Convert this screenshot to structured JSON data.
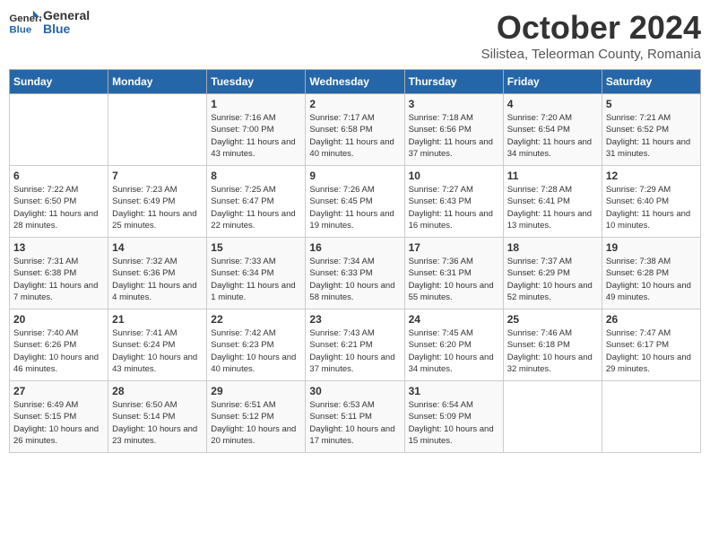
{
  "logo": {
    "general": "General",
    "blue": "Blue"
  },
  "title": "October 2024",
  "subtitle": "Silistea, Teleorman County, Romania",
  "headers": [
    "Sunday",
    "Monday",
    "Tuesday",
    "Wednesday",
    "Thursday",
    "Friday",
    "Saturday"
  ],
  "weeks": [
    [
      {
        "day": "",
        "info": ""
      },
      {
        "day": "",
        "info": ""
      },
      {
        "day": "1",
        "info": "Sunrise: 7:16 AM\nSunset: 7:00 PM\nDaylight: 11 hours and 43 minutes."
      },
      {
        "day": "2",
        "info": "Sunrise: 7:17 AM\nSunset: 6:58 PM\nDaylight: 11 hours and 40 minutes."
      },
      {
        "day": "3",
        "info": "Sunrise: 7:18 AM\nSunset: 6:56 PM\nDaylight: 11 hours and 37 minutes."
      },
      {
        "day": "4",
        "info": "Sunrise: 7:20 AM\nSunset: 6:54 PM\nDaylight: 11 hours and 34 minutes."
      },
      {
        "day": "5",
        "info": "Sunrise: 7:21 AM\nSunset: 6:52 PM\nDaylight: 11 hours and 31 minutes."
      }
    ],
    [
      {
        "day": "6",
        "info": "Sunrise: 7:22 AM\nSunset: 6:50 PM\nDaylight: 11 hours and 28 minutes."
      },
      {
        "day": "7",
        "info": "Sunrise: 7:23 AM\nSunset: 6:49 PM\nDaylight: 11 hours and 25 minutes."
      },
      {
        "day": "8",
        "info": "Sunrise: 7:25 AM\nSunset: 6:47 PM\nDaylight: 11 hours and 22 minutes."
      },
      {
        "day": "9",
        "info": "Sunrise: 7:26 AM\nSunset: 6:45 PM\nDaylight: 11 hours and 19 minutes."
      },
      {
        "day": "10",
        "info": "Sunrise: 7:27 AM\nSunset: 6:43 PM\nDaylight: 11 hours and 16 minutes."
      },
      {
        "day": "11",
        "info": "Sunrise: 7:28 AM\nSunset: 6:41 PM\nDaylight: 11 hours and 13 minutes."
      },
      {
        "day": "12",
        "info": "Sunrise: 7:29 AM\nSunset: 6:40 PM\nDaylight: 11 hours and 10 minutes."
      }
    ],
    [
      {
        "day": "13",
        "info": "Sunrise: 7:31 AM\nSunset: 6:38 PM\nDaylight: 11 hours and 7 minutes."
      },
      {
        "day": "14",
        "info": "Sunrise: 7:32 AM\nSunset: 6:36 PM\nDaylight: 11 hours and 4 minutes."
      },
      {
        "day": "15",
        "info": "Sunrise: 7:33 AM\nSunset: 6:34 PM\nDaylight: 11 hours and 1 minute."
      },
      {
        "day": "16",
        "info": "Sunrise: 7:34 AM\nSunset: 6:33 PM\nDaylight: 10 hours and 58 minutes."
      },
      {
        "day": "17",
        "info": "Sunrise: 7:36 AM\nSunset: 6:31 PM\nDaylight: 10 hours and 55 minutes."
      },
      {
        "day": "18",
        "info": "Sunrise: 7:37 AM\nSunset: 6:29 PM\nDaylight: 10 hours and 52 minutes."
      },
      {
        "day": "19",
        "info": "Sunrise: 7:38 AM\nSunset: 6:28 PM\nDaylight: 10 hours and 49 minutes."
      }
    ],
    [
      {
        "day": "20",
        "info": "Sunrise: 7:40 AM\nSunset: 6:26 PM\nDaylight: 10 hours and 46 minutes."
      },
      {
        "day": "21",
        "info": "Sunrise: 7:41 AM\nSunset: 6:24 PM\nDaylight: 10 hours and 43 minutes."
      },
      {
        "day": "22",
        "info": "Sunrise: 7:42 AM\nSunset: 6:23 PM\nDaylight: 10 hours and 40 minutes."
      },
      {
        "day": "23",
        "info": "Sunrise: 7:43 AM\nSunset: 6:21 PM\nDaylight: 10 hours and 37 minutes."
      },
      {
        "day": "24",
        "info": "Sunrise: 7:45 AM\nSunset: 6:20 PM\nDaylight: 10 hours and 34 minutes."
      },
      {
        "day": "25",
        "info": "Sunrise: 7:46 AM\nSunset: 6:18 PM\nDaylight: 10 hours and 32 minutes."
      },
      {
        "day": "26",
        "info": "Sunrise: 7:47 AM\nSunset: 6:17 PM\nDaylight: 10 hours and 29 minutes."
      }
    ],
    [
      {
        "day": "27",
        "info": "Sunrise: 6:49 AM\nSunset: 5:15 PM\nDaylight: 10 hours and 26 minutes."
      },
      {
        "day": "28",
        "info": "Sunrise: 6:50 AM\nSunset: 5:14 PM\nDaylight: 10 hours and 23 minutes."
      },
      {
        "day": "29",
        "info": "Sunrise: 6:51 AM\nSunset: 5:12 PM\nDaylight: 10 hours and 20 minutes."
      },
      {
        "day": "30",
        "info": "Sunrise: 6:53 AM\nSunset: 5:11 PM\nDaylight: 10 hours and 17 minutes."
      },
      {
        "day": "31",
        "info": "Sunrise: 6:54 AM\nSunset: 5:09 PM\nDaylight: 10 hours and 15 minutes."
      },
      {
        "day": "",
        "info": ""
      },
      {
        "day": "",
        "info": ""
      }
    ]
  ]
}
